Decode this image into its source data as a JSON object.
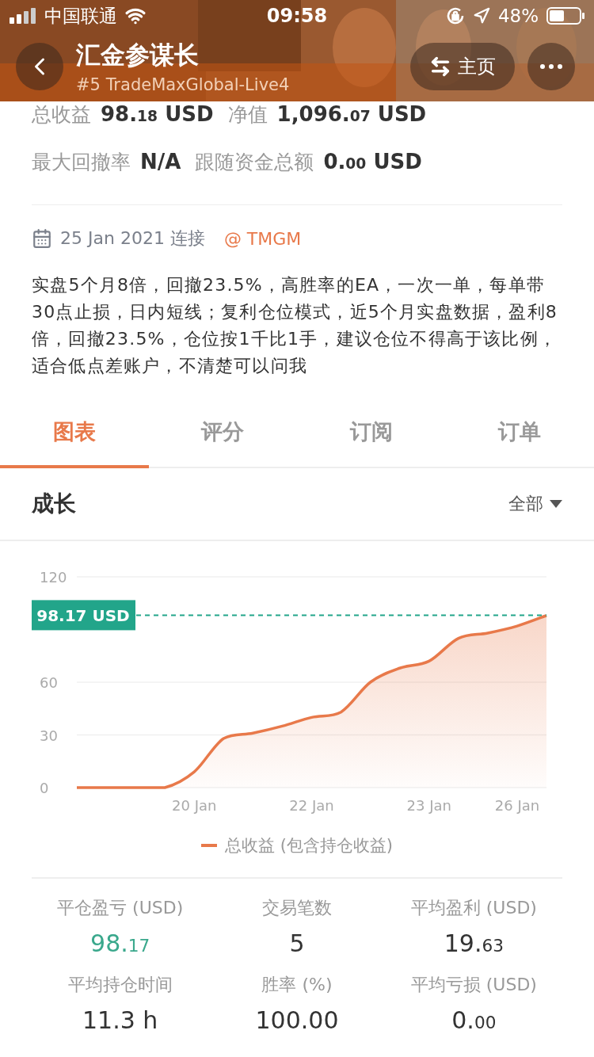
{
  "status_bar": {
    "carrier": "中国联通",
    "time": "09:58",
    "battery": "48%"
  },
  "header": {
    "title": "汇金参谋长",
    "subtitle": "#5 TradeMaxGlobal-Live4",
    "home_button": "主页"
  },
  "summary": [
    {
      "label": "总收益",
      "whole": "98.",
      "fraction": "18",
      "unit": "USD"
    },
    {
      "label": "净值",
      "whole": "1,096.",
      "fraction": "07",
      "unit": "USD"
    },
    {
      "label": "最大回撤率",
      "whole": "N/A"
    },
    {
      "label": "跟随资金总额",
      "whole": "0.",
      "fraction": "00",
      "unit": "USD"
    }
  ],
  "meta": {
    "date": "25 Jan 2021 连接",
    "broker": "@ TMGM"
  },
  "description": "实盘5个月8倍，回撤23.5%，高胜率的EA，一次一单，每单带30点止损，日内短线；复利仓位模式，近5个月实盘数据，盈利8倍，回撤23.5%，仓位按1千比1手，建议仓位不得高于该比例，适合低点差账户，不清楚可以问我",
  "tabs": [
    {
      "label": "图表",
      "selected": true
    },
    {
      "label": "评分",
      "selected": false
    },
    {
      "label": "订阅",
      "selected": false
    },
    {
      "label": "订单",
      "selected": false
    }
  ],
  "section": {
    "title": "成长",
    "filter": "全部"
  },
  "chart": {
    "chart_data": {
      "type": "area",
      "ref_lines": [
        {
          "axis": "y",
          "value": 98.17,
          "label": "98.17 USD",
          "color": "#22a58a"
        }
      ],
      "categories": [
        null,
        null,
        null,
        null,
        "20 Jan",
        null,
        null,
        null,
        "22 Jan",
        null,
        null,
        null,
        "23 Jan",
        null,
        null,
        "26 Jan",
        null
      ],
      "series": [
        {
          "name": "总收益 (包含持仓收益)",
          "color": "#e8794a",
          "values": [
            0,
            0,
            0,
            0,
            9,
            28,
            31,
            35,
            40,
            43,
            60,
            68,
            72,
            85,
            88,
            92,
            98
          ]
        }
      ],
      "ylim": [
        0,
        120
      ],
      "yticks": [
        0,
        30,
        60,
        120
      ]
    }
  },
  "stats": [
    {
      "label": "平仓盈亏 (USD)",
      "whole": "98.",
      "fraction": "17",
      "positive": true
    },
    {
      "label": "交易笔数",
      "whole": "5",
      "positive": false
    },
    {
      "label": "平均盈利 (USD)",
      "whole": "19.",
      "fraction": "63",
      "positive": false
    },
    {
      "label": "平均持仓时间",
      "whole": "11.3 h",
      "positive": false
    },
    {
      "label": "胜率 (%)",
      "whole": "100.00",
      "positive": false
    },
    {
      "label": "平均亏损 (USD)",
      "whole": "0.",
      "fraction": "00",
      "positive": false
    }
  ]
}
